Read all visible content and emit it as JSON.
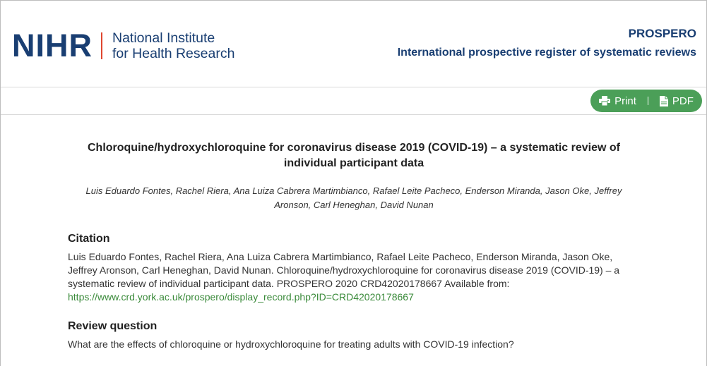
{
  "header": {
    "logo_mark": "NIHR",
    "logo_line1": "National Institute",
    "logo_line2": "for Health Research",
    "prospero_title": "PROSPERO",
    "prospero_subtitle": "International prospective register of systematic reviews",
    "brand_color": "#193e72",
    "accent_color": "#e0462f"
  },
  "toolbar": {
    "print_label": "Print",
    "pdf_label": "PDF",
    "print_icon": "printer-icon",
    "pdf_icon": "pdf-file-icon",
    "pill_color": "#4b9f58"
  },
  "record": {
    "title": "Chloroquine/hydroxychloroquine for coronavirus disease 2019 (COVID-19) – a systematic review of individual participant data",
    "authors": "Luis Eduardo Fontes, Rachel Riera, Ana Luiza Cabrera Martimbianco, Rafael Leite Pacheco, Enderson Miranda, Jason Oke, Jeffrey Aronson, Carl Heneghan, David Nunan"
  },
  "citation": {
    "heading": "Citation",
    "text": "Luis Eduardo Fontes, Rachel Riera, Ana Luiza Cabrera Martimbianco, Rafael Leite Pacheco, Enderson Miranda, Jason Oke, Jeffrey Aronson, Carl Heneghan, David Nunan. Chloroquine/hydroxychloroquine for coronavirus disease 2019 (COVID-19) – a systematic review of individual participant data. PROSPERO 2020 CRD42020178667 Available from: ",
    "link_text": "https://www.crd.york.ac.uk/prospero/display_record.php?ID=CRD42020178667",
    "link_color": "#3a8a3a"
  },
  "review_question": {
    "heading": "Review question",
    "text": "What are the effects of chloroquine or hydroxychloroquine for treating adults with COVID-19 infection?"
  }
}
